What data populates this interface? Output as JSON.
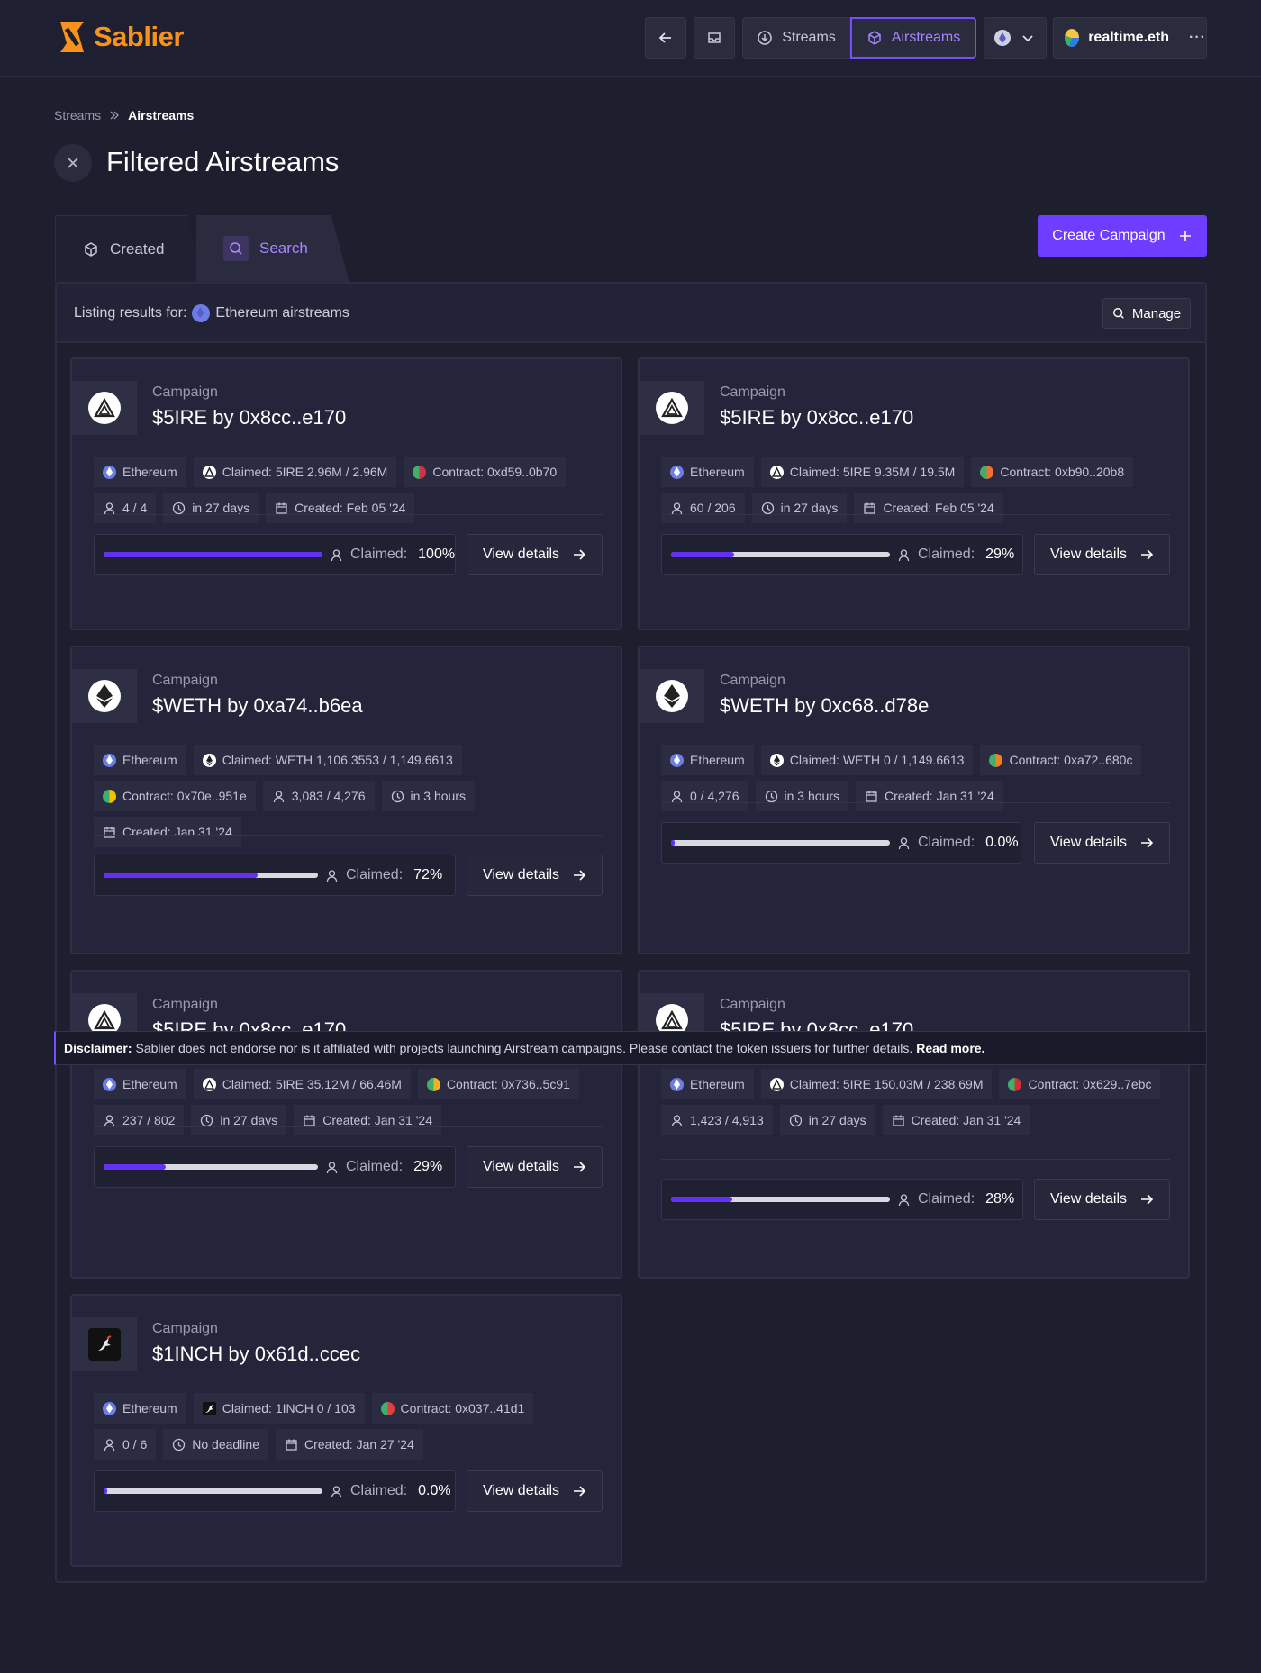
{
  "header": {
    "brand": "Sablier",
    "nav": {
      "streams": "Streams",
      "airstreams": "Airstreams"
    },
    "account": {
      "name": "realtime.eth",
      "more": "···"
    },
    "colors": {
      "accent": "#7a4cff",
      "brand": "#f7931a"
    }
  },
  "breadcrumb": {
    "root": "Streams",
    "current": "Airstreams"
  },
  "page": {
    "title": "Filtered Airstreams"
  },
  "tabs": {
    "created": "Created",
    "search": "Search"
  },
  "create_button": "Create Campaign",
  "listing": {
    "prefix": "Listing results for:",
    "chain": "Ethereum airstreams",
    "manage": "Manage"
  },
  "campaign_label": "Campaign",
  "claimed_label": "Claimed:",
  "view_details": "View details",
  "cards": [
    {
      "title": "$5IRE by 0x8cc..e170",
      "logo": "5ire-icon",
      "tags": [
        "Ethereum",
        "Claimed: 5IRE 2.96M / 2.96M",
        "Contract: 0xd59..0b70",
        "4 / 4",
        "in 27 days",
        "Created: Feb 05 '24"
      ],
      "claimed_pct": "100%",
      "progress": 1.0
    },
    {
      "title": "$5IRE by 0x8cc..e170",
      "logo": "5ire-icon",
      "tags": [
        "Ethereum",
        "Claimed: 5IRE 9.35M / 19.5M",
        "Contract: 0xb90..20b8",
        "60 / 206",
        "in 27 days",
        "Created: Feb 05 '24"
      ],
      "claimed_pct": "29%",
      "progress": 0.29
    },
    {
      "title": "$WETH by 0xa74..b6ea",
      "logo": "eth-icon",
      "tags": [
        "Ethereum",
        "Claimed: WETH 1,106.3553 / 1,149.6613",
        "Contract: 0x70e..951e",
        "3,083 / 4,276",
        "in 3 hours",
        "Created: Jan 31 '24"
      ],
      "claimed_pct": "72%",
      "progress": 0.72
    },
    {
      "title": "$WETH by 0xc68..d78e",
      "logo": "eth-icon",
      "tags": [
        "Ethereum",
        "Claimed: WETH 0 / 1,149.6613",
        "Contract: 0xa72..680c",
        "0 / 4,276",
        "in 3 hours",
        "Created: Jan 31 '24"
      ],
      "claimed_pct": "0.0%",
      "progress": 0.0
    },
    {
      "title": "$5IRE by 0x8cc..e170",
      "logo": "5ire-icon",
      "tags": [
        "Ethereum",
        "Claimed: 5IRE 35.12M / 66.46M",
        "Contract: 0x736..5c91",
        "237 / 802",
        "in 27 days",
        "Created: Jan 31 '24"
      ],
      "claimed_pct": "29%",
      "progress": 0.29
    },
    {
      "title": "$5IRE by 0x8cc..e170",
      "logo": "5ire-icon",
      "tags": [
        "Ethereum",
        "Claimed: 5IRE 150.03M / 238.69M",
        "Contract: 0x629..7ebc",
        "1,423 / 4,913",
        "in 27 days",
        "Created: Jan 31 '24"
      ],
      "claimed_pct": "28%",
      "progress": 0.28
    },
    {
      "title": "$1INCH by 0x61d..ccec",
      "logo": "1inch-icon",
      "tags": [
        "Ethereum",
        "Claimed: 1INCH 0 / 103",
        "Contract: 0x037..41d1",
        "0 / 6",
        "No deadline",
        "Created: Jan 27 '24"
      ],
      "claimed_pct": "0.0%",
      "progress": 0.0
    }
  ],
  "disclaimer": {
    "label": "Disclaimer:",
    "text": "Sablier does not endorse nor is it affiliated with projects launching Airstream campaigns. Please contact the token issuers for further details.",
    "link": "Read more."
  }
}
